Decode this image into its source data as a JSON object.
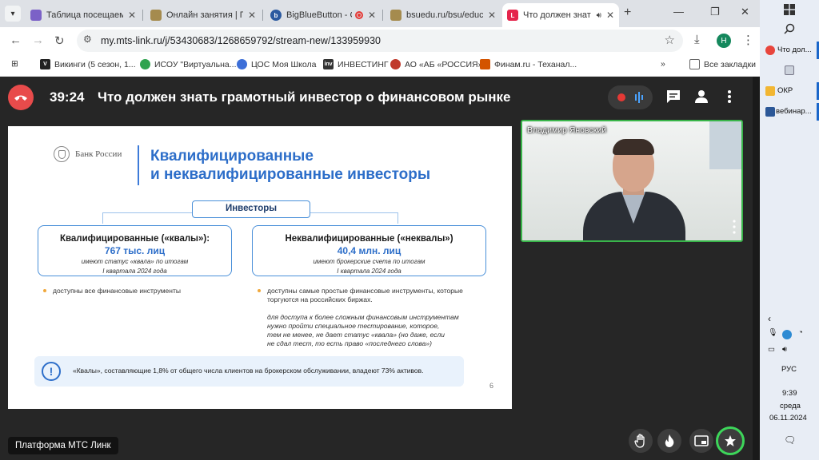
{
  "browser": {
    "tabs": [
      {
        "title": "Таблица посещаемо",
        "fav_color": "#7b61c7",
        "fav_text": ""
      },
      {
        "title": "Онлайн занятия | Пе",
        "fav_color": "#a58b4e",
        "fav_text": ""
      },
      {
        "title": "BigBlueButton - C",
        "fav_color": "#2c5aa0",
        "fav_text": "b"
      },
      {
        "title": "bsuedu.ru/bsu/educa",
        "fav_color": "#a58b4e",
        "fav_text": ""
      },
      {
        "title": "Что должен знат",
        "fav_color": "#e5254c",
        "fav_text": "L"
      }
    ],
    "new_tab": "+",
    "url": "my.mts-link.ru/j/53430683/1268659792/stream-new/133959930",
    "profile_initial": "Н",
    "bookmarks": [
      {
        "label": "Викинги (5 сезон, 1...",
        "color": "#222222",
        "icon": "V"
      },
      {
        "label": "ИСОУ \"Виртуальна...",
        "color": "#2fa34e",
        "icon": ""
      },
      {
        "label": "ЦОС Моя Школа",
        "color": "#3d6fd8",
        "icon": ""
      },
      {
        "label": "ИНВЕСТИНГ",
        "color": "#333333",
        "icon": "inv"
      },
      {
        "label": "АО «АБ «РОССИЯ»",
        "color": "#c0392b",
        "icon": ""
      },
      {
        "label": "Финам.ru - Теханал...",
        "color": "#d35400",
        "icon": ""
      }
    ],
    "all_bookmarks": "Все закладки"
  },
  "webinar": {
    "timer": "39:24",
    "title": "Что должен знать грамотный инвестор о финансовом рынке",
    "presenter_name": "Владимир Яновский",
    "platform": "Платформа МТС Линк",
    "accent": "#39b54a"
  },
  "slide": {
    "logo_text": "Банк России",
    "heading_line1": "Квалифицированные",
    "heading_line2": "и неквалифицированные инвесторы",
    "root_label": "Инвесторы",
    "left": {
      "title": "Квалифицированные («квалы»):",
      "number": "767 тыс. лиц",
      "sub1": "имеют статус «квала» по итогам",
      "sub2": "I квартала 2024 года",
      "bullet": "доступны все финансовые инструменты"
    },
    "right": {
      "title": "Неквалифицированные («неквалы»)",
      "number": "40,4 млн. лиц",
      "sub1": "имеют брокерские счета по итогам",
      "sub2": "I квартала 2024 года",
      "bullet1": "доступны самые простые финансовые инструменты, которые",
      "bullet2": "торгуются на российских биржах.",
      "italic": [
        "для доступа к более сложным финансовым инструментам",
        "нужно пройти специальное тестирование, которое,",
        "тем не менее, не дает статус «квала» (но даже, если",
        "не сдал тест, то есть право «последнего слова»)"
      ]
    },
    "note_icon": "!",
    "note": "«Квалы», составляющие 1,8% от общего числа клиентов на брокерском обслуживании, владеют 73% активов.",
    "page_number": "6"
  },
  "taskbar": {
    "items": [
      {
        "label": "Что дол...",
        "color": "#e8453c"
      },
      {
        "label": "ОКР",
        "color": "#f2b632"
      },
      {
        "label": "вебинар...",
        "color": "#2b5797"
      }
    ],
    "language": "РУС",
    "time": "9:39",
    "weekday": "среда",
    "date": "06.11.2024"
  }
}
